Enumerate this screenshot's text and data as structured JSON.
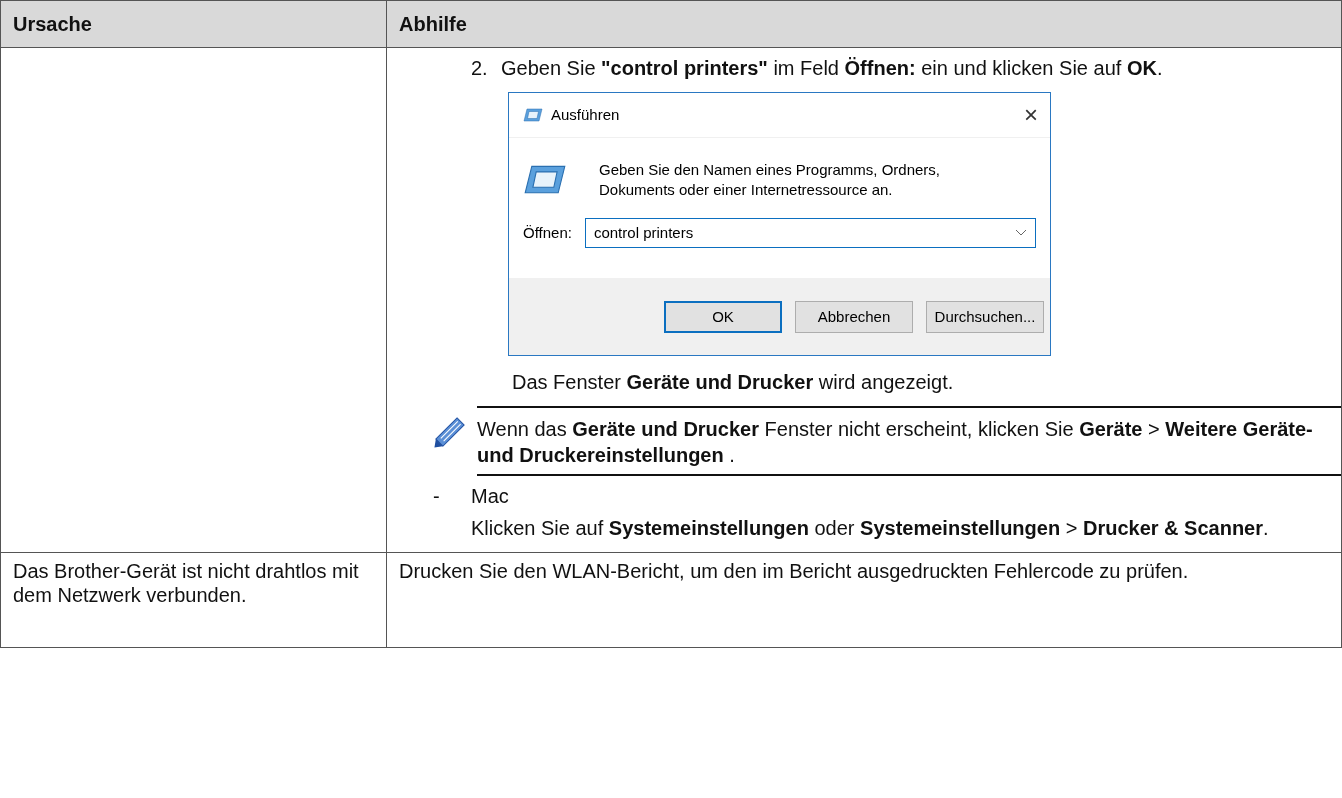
{
  "table": {
    "columns": [
      "Ursache",
      "Abhilfe"
    ],
    "rows": [
      {
        "remedy": {
          "step": {
            "number": "2.",
            "text": "Geben Sie **\"control printers\"** im Feld **Öffnen:** ein und klicken Sie auf **OK**."
          },
          "dialog": {
            "title": "Ausführen",
            "close": "×",
            "message": "Geben Sie den Namen eines Programms, Ordners, Dokuments oder einer Internetressource an.",
            "field_label": "Öffnen:",
            "field_value": "control printers",
            "buttons": [
              {
                "label": "OK",
                "default": true
              },
              {
                "label": "Abbrechen",
                "default": false
              },
              {
                "label": "Durchsuchen...",
                "default": false
              }
            ]
          },
          "result": "Das Fenster **Geräte und Drucker** wird angezeigt.",
          "note": "Wenn das **Geräte und Drucker** Fenster nicht erscheint, klicken Sie **Geräte** > **Weitere Geräte- und Druckereinstellungen** .",
          "bullet": {
            "marker": "-",
            "label": "Mac"
          },
          "bullet_text": "Klicken Sie auf **Systemeinstellungen** oder **Systemeinstellungen** > **Drucker & Scanner**."
        }
      },
      {
        "cause": "Das Brother-Gerät ist nicht drahtlos mit dem Netzwerk verbunden.",
        "remedy": {
          "text": "Drucken Sie den WLAN-Bericht, um den im Bericht ausgedruckten Fehlercode zu prüfen."
        }
      }
    ]
  }
}
